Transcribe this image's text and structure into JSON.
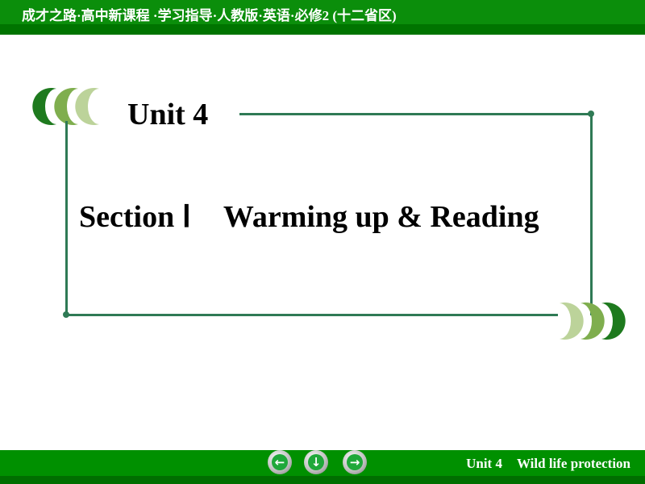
{
  "header": {
    "title": "成才之路·高中新课程 ·学习指导·人教版·英语·必修2 (十二省区)"
  },
  "slide": {
    "unit": "Unit 4",
    "section": "Section Ⅰ",
    "section_title": "Warming up & Reading"
  },
  "footer": {
    "unit": "Unit 4",
    "topic": "Wild life protection",
    "nav": [
      {
        "icon": "arrow-left-icon",
        "glyph": "←"
      },
      {
        "icon": "arrow-down-icon",
        "glyph": "↓"
      },
      {
        "icon": "arrow-right-icon",
        "glyph": "→"
      }
    ]
  },
  "colors": {
    "header_green": "#0b8e0b",
    "frame": "#2f7a55",
    "crescent_dark": "#1e7a1e",
    "crescent_mid": "#7fae4e",
    "crescent_light": "#bcd39a"
  }
}
